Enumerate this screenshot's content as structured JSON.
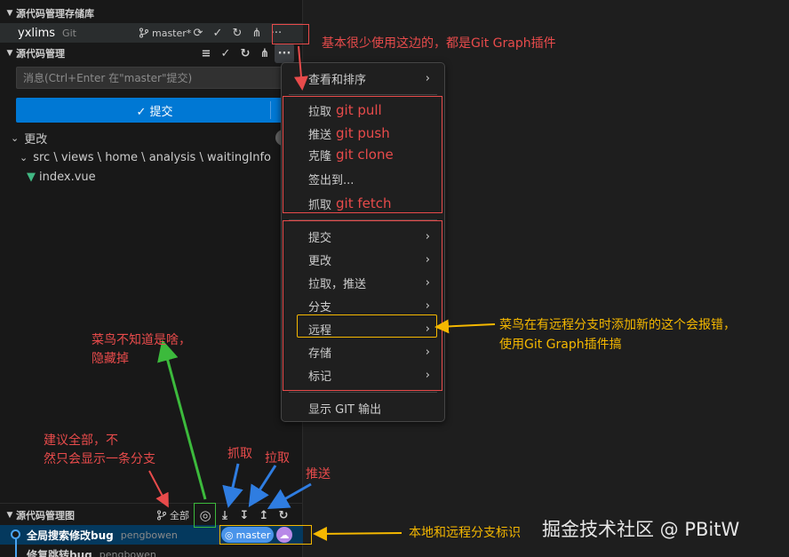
{
  "repos": {
    "header": "源代码管理存储库",
    "repo_name": "yxlims",
    "repo_type": "Git",
    "branch": "master*"
  },
  "scm": {
    "header": "源代码管理",
    "message_placeholder": "消息(Ctrl+Enter 在\"master\"提交)",
    "commit_label": "✓ 提交",
    "changes_label": "更改",
    "folder_path": "src \\ views \\ home \\ analysis \\ waitingInfo",
    "file_name": "index.vue"
  },
  "menu": {
    "items": [
      {
        "label": "查看和排序",
        "suffix": "",
        "submenu": true
      },
      {
        "label": "拉取",
        "suffix": "git pull",
        "submenu": false
      },
      {
        "label": "推送",
        "suffix": "git push",
        "submenu": false
      },
      {
        "label": "克隆",
        "suffix": "git clone",
        "submenu": false
      },
      {
        "label": "签出到...",
        "suffix": "",
        "submenu": false
      },
      {
        "label": "抓取",
        "suffix": "git fetch",
        "submenu": false
      },
      {
        "label": "提交",
        "suffix": "",
        "submenu": true
      },
      {
        "label": "更改",
        "suffix": "",
        "submenu": true
      },
      {
        "label": "拉取，推送",
        "suffix": "",
        "submenu": true
      },
      {
        "label": "分支",
        "suffix": "",
        "submenu": true
      },
      {
        "label": "远程",
        "suffix": "",
        "submenu": true
      },
      {
        "label": "存储",
        "suffix": "",
        "submenu": true
      },
      {
        "label": "标记",
        "suffix": "",
        "submenu": true
      },
      {
        "label": "显示 GIT 输出",
        "suffix": "",
        "submenu": false
      }
    ]
  },
  "graph": {
    "header": "源代码管理图",
    "all_label": "全部",
    "commits": [
      {
        "message": "全局搜索修改bug",
        "author": "pengbowen"
      },
      {
        "message": "修复跳转bug",
        "author": "pengbowen"
      }
    ],
    "branch_tag": "master"
  },
  "annotations": {
    "top": "基本很少使用这边的，都是Git Graph插件",
    "remote_1": "菜鸟在有远程分支时添加新的这个会报错，",
    "remote_2": "使用Git Graph插件搞",
    "unknown_1": "菜鸟不知道是啥，",
    "unknown_2": "隐藏掉",
    "all_1": "建议全部，不",
    "all_2": "然只会显示一条分支",
    "fetch": "抓取",
    "pull": "拉取",
    "push": "推送",
    "branch_mark": "本地和远程分支标识"
  },
  "watermark": "掘金技术社区 @ PBitW",
  "colors": {
    "accent": "#0078d4",
    "annotation_red": "#e84b4b",
    "annotation_orange": "#f5b800",
    "annotation_green": "#3cba3c",
    "annotation_blue": "#2f7de1"
  }
}
